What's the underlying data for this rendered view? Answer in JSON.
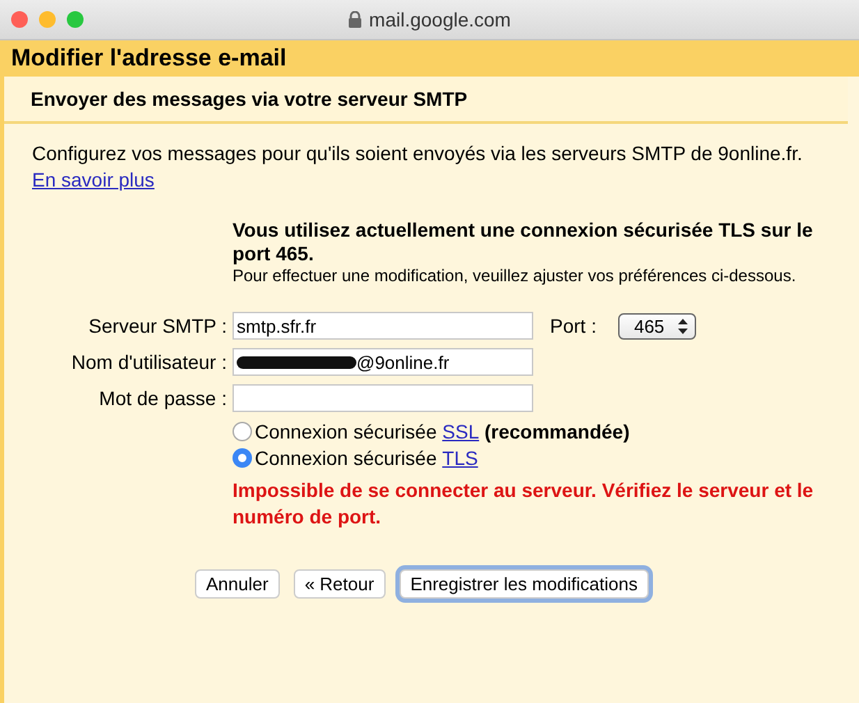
{
  "browser": {
    "address": "mail.google.com"
  },
  "dialog": {
    "title": "Modifier l'adresse e-mail",
    "subtitle": "Envoyer des messages via votre serveur SMTP",
    "intro": "Configurez vos messages pour qu'ils soient envoyés via les serveurs SMTP de 9online.fr.",
    "intro_link": "En savoir plus",
    "notice_title": "Vous utilisez actuellement une connexion sécurisée TLS sur le port 465.",
    "notice_text": "Pour effectuer une modification, veuillez ajuster vos préférences ci-dessous.",
    "fields": [
      {
        "label": "Serveur SMTP :",
        "value": "smtp.sfr.fr",
        "redacted": false
      },
      {
        "label": "Nom d'utilisateur :",
        "value": "@9online.fr",
        "redacted": true
      },
      {
        "label": "Mot de passe :",
        "redacted": false
      }
    ],
    "port": {
      "label": "Port :",
      "value": "465"
    },
    "security": [
      {
        "text": "Connexion sécurisée",
        "link": "SSL",
        "note": "(recommandée)",
        "selected": false
      },
      {
        "text": "Connexion sécurisée",
        "link": "TLS",
        "selected": true
      }
    ],
    "error": "Impossible de se connecter au serveur. Vérifiez le serveur et le numéro de port.",
    "buttons": [
      {
        "label": "Annuler",
        "focused": false
      },
      {
        "label": "« Retour",
        "focused": false
      },
      {
        "label": "Enregistrer les modifications",
        "focused": true
      }
    ]
  }
}
